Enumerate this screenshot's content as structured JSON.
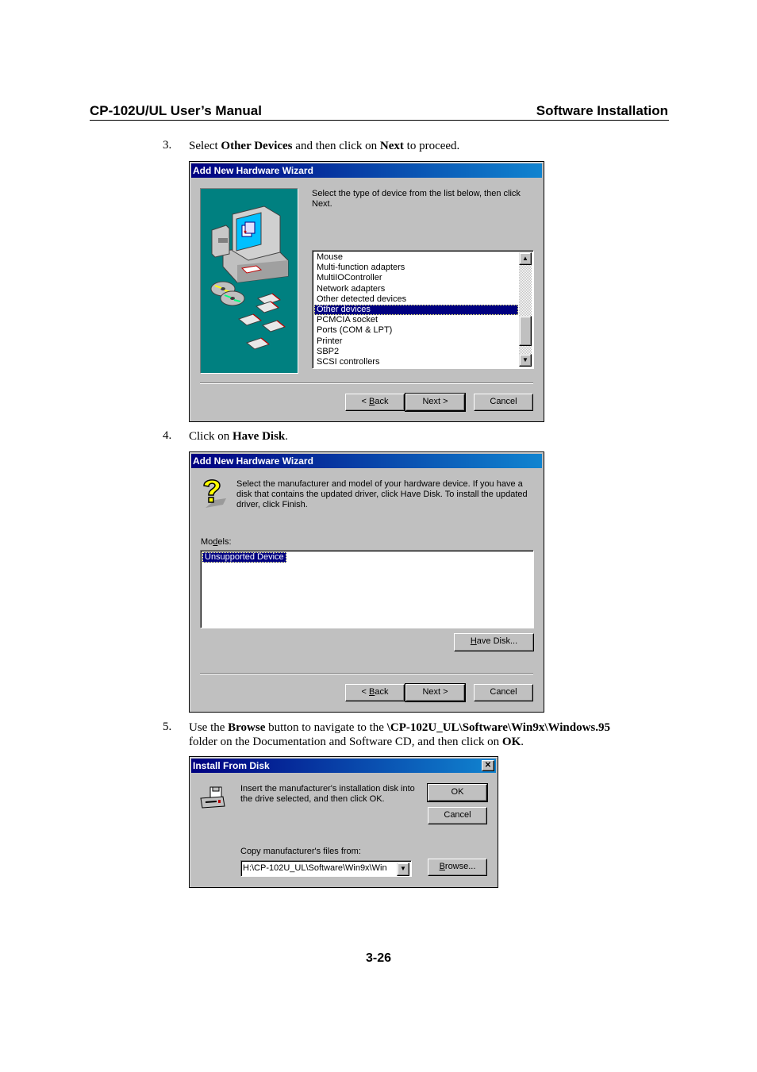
{
  "header": {
    "left": "CP-102U/UL  User’s  Manual",
    "right": "Software  Installation"
  },
  "steps": [
    {
      "num": "3.",
      "parts": [
        "Select ",
        "Other Devices",
        " and then click on ",
        "Next",
        " to proceed."
      ]
    },
    {
      "num": "4.",
      "parts": [
        "Click on ",
        "Have Disk",
        "."
      ]
    },
    {
      "num": "5.",
      "line1": [
        "Use the ",
        "Browse",
        " button to navigate to the ",
        "\\CP-102U_UL\\Software\\Win9x\\Windows.95"
      ],
      "line2": [
        "folder on the Documentation and Software CD, and then click on ",
        "OK",
        "."
      ]
    }
  ],
  "dialog1": {
    "title": "Add New Hardware Wizard",
    "instruction": "Select the type of device from the list below, then click Next.",
    "device_types": [
      "Mouse",
      "Multi-function adapters",
      "MultiIOController",
      "Network adapters",
      "Other detected devices",
      "Other devices",
      "PCMCIA socket",
      "Ports (COM & LPT)",
      "Printer",
      "SBP2",
      "SCSI controllers"
    ],
    "selected": "Other devices",
    "buttons": {
      "back_pre": "< ",
      "back_u": "B",
      "back_post": "ack",
      "next": "Next >",
      "cancel": "Cancel"
    }
  },
  "dialog2": {
    "title": "Add New Hardware Wizard",
    "instruction": "Select the manufacturer and model of your hardware device. If you have a disk that contains the updated driver, click Have Disk. To install the updated driver, click Finish.",
    "models_label_pre": "Mo",
    "models_label_u": "d",
    "models_label_post": "els:",
    "models": [
      "Unsupported Device"
    ],
    "have_disk_u": "H",
    "have_disk_post": "ave Disk...",
    "buttons": {
      "back_pre": "< ",
      "back_u": "B",
      "back_post": "ack",
      "next": "Next >",
      "cancel": "Cancel"
    }
  },
  "dialog3": {
    "title": "Install From Disk",
    "close": "✕",
    "instruction": "Insert the manufacturer's installation disk into the drive selected, and then click OK.",
    "ok": "OK",
    "cancel": "Cancel",
    "copy_label": "Copy manufacturer's files from:",
    "path_value": "H:\\CP-102U_UL\\Software\\Win9x\\Win",
    "browse_u": "B",
    "browse_post": "rowse..."
  },
  "colors": {
    "titlebar_start": "#000080",
    "titlebar_end": "#1084d0",
    "dialog_bg": "#c0c0c0",
    "wizard_panel": "#008080",
    "selection": "#000080"
  },
  "footer": {
    "page_number": "3-26"
  }
}
